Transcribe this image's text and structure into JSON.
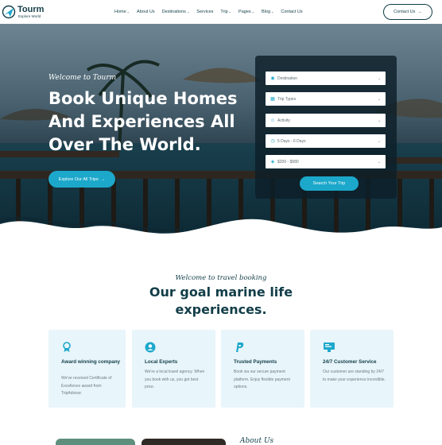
{
  "header": {
    "logo": {
      "name": "Tourm",
      "tagline": "Explore World"
    },
    "nav": [
      {
        "label": "Home",
        "has_dropdown": true,
        "key": "home"
      },
      {
        "label": "About Us",
        "has_dropdown": false,
        "key": "about"
      },
      {
        "label": "Destinations",
        "has_dropdown": true,
        "key": "destinations"
      },
      {
        "label": "Services",
        "has_dropdown": false,
        "key": "services"
      },
      {
        "label": "Trip",
        "has_dropdown": true,
        "key": "trip"
      },
      {
        "label": "Pages",
        "has_dropdown": true,
        "key": "pages"
      },
      {
        "label": "Blog",
        "has_dropdown": true,
        "key": "blog"
      },
      {
        "label": "Contact Us",
        "has_dropdown": false,
        "key": "contact"
      }
    ],
    "contact_button": "Contact Us"
  },
  "hero": {
    "subtitle": "Welcome to Tourm",
    "title": "Book Unique Homes And Experiences All Over The World.",
    "cta": "Explore Our All Trips"
  },
  "search": {
    "fields": [
      {
        "key": "destination",
        "icon": "map-pin-icon",
        "value": "Destination"
      },
      {
        "key": "trip-types",
        "icon": "grid-icon",
        "value": "Trip Types"
      },
      {
        "key": "activity",
        "icon": "person-icon",
        "value": "Activity"
      },
      {
        "key": "duration",
        "icon": "clock-icon",
        "value": "5 Days - 6 Days"
      },
      {
        "key": "price",
        "icon": "price-tag-icon",
        "value": "$200 - $580"
      }
    ],
    "button": "Search Your Trip"
  },
  "intro": {
    "subtitle": "Welcome to travel booking",
    "title": "Our goal marine life experiences."
  },
  "features": [
    {
      "key": "award",
      "icon": "award-ribbon-icon",
      "title": "Award winning company",
      "text": "We've received Certificate of Excellence award from TripAdvisor."
    },
    {
      "key": "experts",
      "icon": "expert-user-icon",
      "title": "Local Experts",
      "text": "We're a local travel agency. When you book with us, you get best price."
    },
    {
      "key": "payments",
      "icon": "paypal-icon",
      "title": "Trusted Payments",
      "text": "Book via our secure payment platform. Enjoy flexible payment options."
    },
    {
      "key": "support",
      "icon": "support-headset-icon",
      "title": "24/7 Customer Service",
      "text": "Our customer are standing by 24/7 to make your experience incredible."
    }
  ],
  "about": {
    "subtitle": "About Us"
  },
  "colors": {
    "primary": "#113d48",
    "accent": "#1ca8cb",
    "card_bg": "#e8f5fa",
    "text_muted": "#6e7c82"
  }
}
